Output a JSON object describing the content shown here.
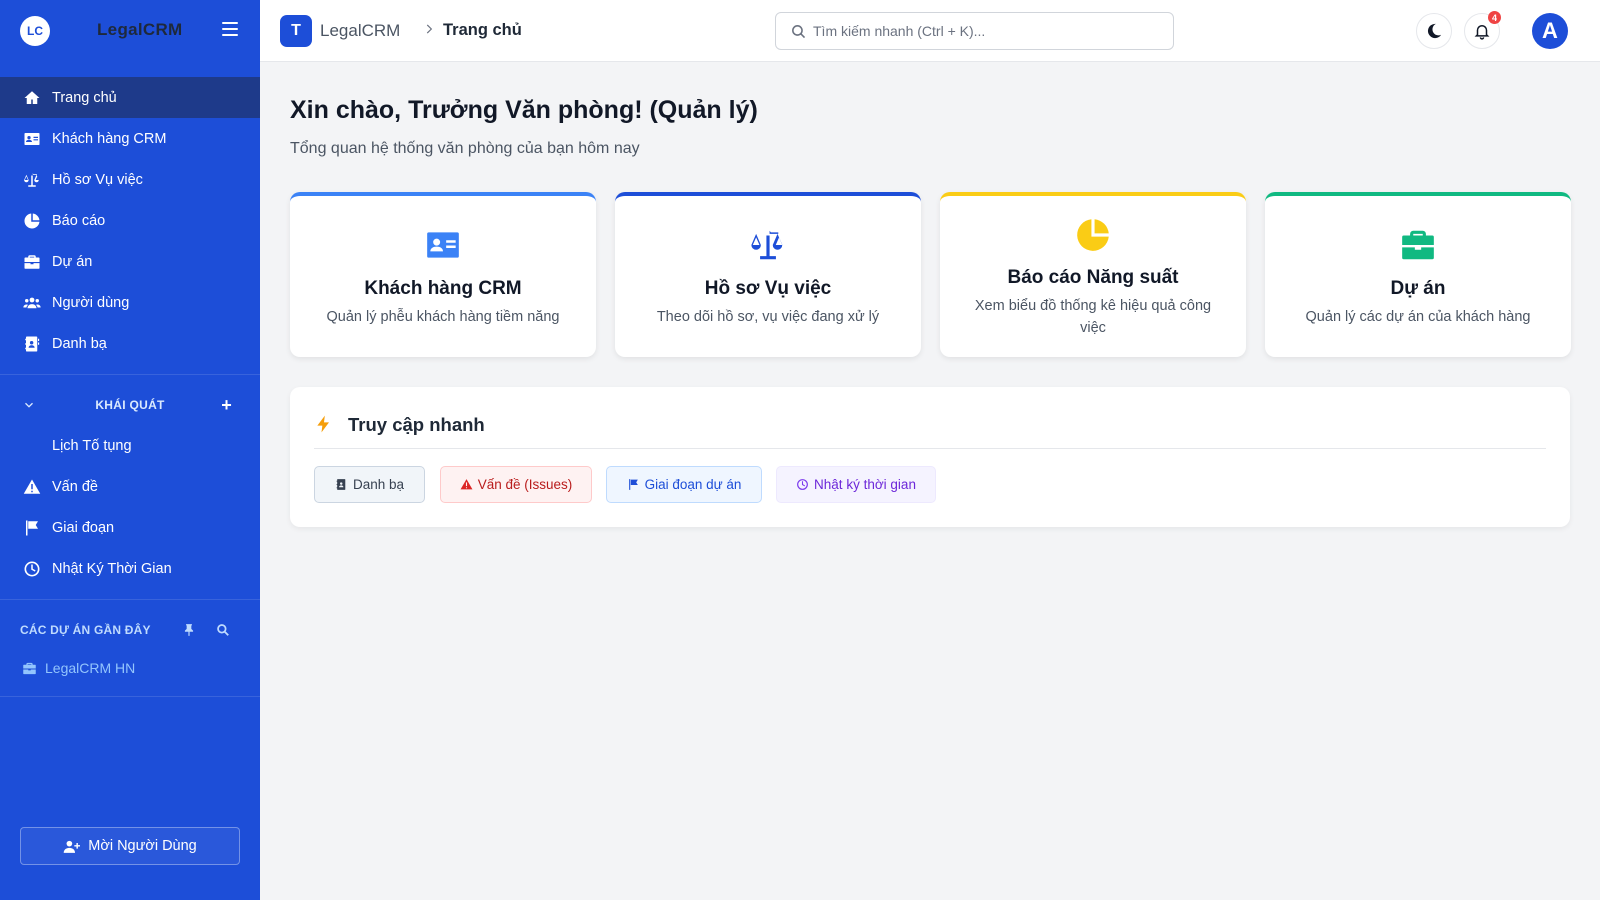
{
  "sidebar": {
    "logo": "LC",
    "brand": "LegalCRM",
    "nav": [
      {
        "label": "Trang chủ",
        "icon": "home-icon"
      },
      {
        "label": "Khách hàng CRM",
        "icon": "id-card-icon"
      },
      {
        "label": "Hồ sơ Vụ việc",
        "icon": "scale-icon"
      },
      {
        "label": "Báo cáo",
        "icon": "pie-chart-icon"
      },
      {
        "label": "Dự án",
        "icon": "briefcase-icon"
      },
      {
        "label": "Người dùng",
        "icon": "users-icon"
      },
      {
        "label": "Danh bạ",
        "icon": "address-book-icon"
      }
    ],
    "section_title": "KHÁI QUÁT",
    "section_items": [
      {
        "label": "Lịch Tố tụng",
        "icon": ""
      },
      {
        "label": "Vấn đề",
        "icon": "warning-icon"
      },
      {
        "label": "Giai đoạn",
        "icon": "flag-icon"
      },
      {
        "label": "Nhật Ký Thời Gian",
        "icon": "clock-icon"
      }
    ],
    "recent_title": "CÁC DỰ ÁN GẦN ĐÂY",
    "recent_projects": [
      {
        "label": "LegalCRM HN",
        "icon": "briefcase-icon"
      }
    ],
    "invite_label": "Mời Người Dùng",
    "colors": {
      "bg": "#1d4ed8",
      "active": "#1e3a8a"
    }
  },
  "topbar": {
    "logo_letter": "T",
    "app_name": "LegalCRM",
    "page": "Trang chủ",
    "search_placeholder": "Tìm kiếm nhanh (Ctrl + K)...",
    "notifications": "4",
    "avatar": "A"
  },
  "main": {
    "greeting": "Xin chào, Trưởng Văn phòng! (Quản lý)",
    "subtitle": "Tổng quan hệ thống văn phòng của bạn hôm nay",
    "cards": [
      {
        "title": "Khách hàng CRM",
        "desc": "Quản lý phễu khách hàng tiềm năng",
        "icon": "id-card-icon",
        "color": "#3b82f6"
      },
      {
        "title": "Hồ sơ Vụ việc",
        "desc": "Theo dõi hồ sơ, vụ việc đang xử lý",
        "icon": "scale-icon",
        "color": "#1d4ed8"
      },
      {
        "title": "Báo cáo Năng suất",
        "desc": "Xem biểu đồ thống kê hiệu quả công việc",
        "icon": "pie-chart-icon",
        "color": "#facc15"
      },
      {
        "title": "Dự án",
        "desc": "Quản lý các dự án của khách hàng",
        "icon": "briefcase-icon",
        "color": "#10b981"
      }
    ],
    "quick": {
      "title": "Truy cập nhanh",
      "buttons": [
        {
          "label": "Danh bạ",
          "icon": "address-book-icon",
          "color": "#374151",
          "bg": "#f1f5f9",
          "border": "#cbd5e1"
        },
        {
          "label": "Vấn đề (Issues)",
          "icon": "warning-icon",
          "color": "#b91c1c",
          "bg": "#fef2f2",
          "border": "#fecaca"
        },
        {
          "label": "Giai đoạn dự án",
          "icon": "flag-icon",
          "color": "#1d4ed8",
          "bg": "#eff6ff",
          "border": "#bfdbfe"
        },
        {
          "label": "Nhật ký thời gian",
          "icon": "clock-icon",
          "color": "#6d28d9",
          "bg": "#f5f3ff",
          "border": "#ede9fe"
        }
      ]
    }
  }
}
